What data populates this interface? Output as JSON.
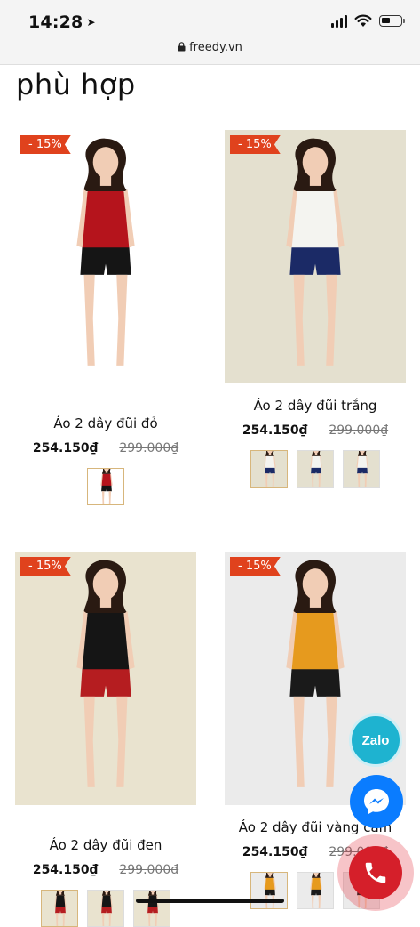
{
  "status_bar": {
    "time": "14:28"
  },
  "browser": {
    "url": "freedy.vn"
  },
  "section": {
    "heading": "phù hợp"
  },
  "products": [
    {
      "badge": "- 15%",
      "name": "Áo 2 dây đũi đỏ",
      "price": "254.150₫",
      "old_price": "299.000₫",
      "top_color": "#b5141c",
      "bottom_color": "#151515",
      "background": "#ffffff",
      "swatch_count": 1
    },
    {
      "badge": "- 15%",
      "name": "Áo 2 dây đũi trắng",
      "price": "254.150₫",
      "old_price": "299.000₫",
      "top_color": "#f4f4f0",
      "bottom_color": "#1b2a66",
      "background": "#e4e0cf",
      "swatch_count": 3
    },
    {
      "badge": "- 15%",
      "name": "Áo 2 dây đũi đen",
      "price": "254.150₫",
      "old_price": "299.000₫",
      "top_color": "#151515",
      "bottom_color": "#b51d20",
      "background": "#e9e3cf",
      "swatch_count": 3
    },
    {
      "badge": "- 15%",
      "name": "Áo 2 dây đũi vàng cam",
      "price": "254.150₫",
      "old_price": "299.000₫",
      "top_color": "#e69a1e",
      "bottom_color": "#1a1a1a",
      "background": "#ebebeb",
      "swatch_count": 3
    }
  ],
  "floating": {
    "zalo_label": "Zalo"
  },
  "colors": {
    "badge": "#e0421d",
    "zalo": "#1eb3d0",
    "messenger": "#0a7cff",
    "call": "#d51f2a"
  }
}
